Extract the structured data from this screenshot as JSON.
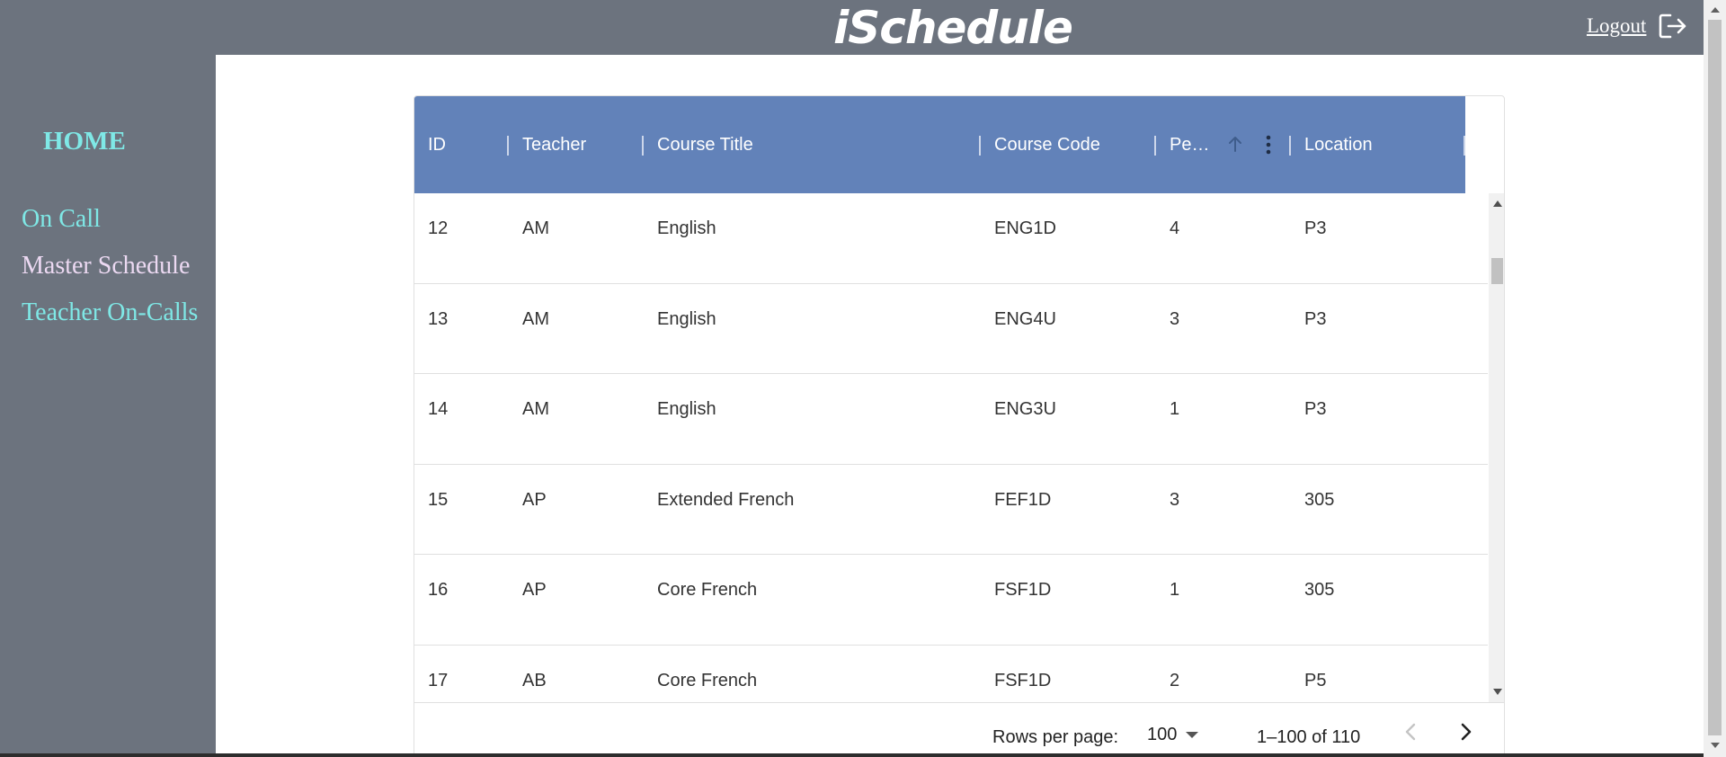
{
  "header": {
    "app_title": "iSchedule",
    "logout_label": "Logout",
    "logout_icon": "logout-icon"
  },
  "sidebar": {
    "home_label": "HOME",
    "items": [
      {
        "label": "On Call",
        "color": "#7fe8e6"
      },
      {
        "label": "Master Schedule",
        "color": "#ecd9f2"
      },
      {
        "label": "Teacher On-Calls",
        "color": "#7fe8e6"
      }
    ]
  },
  "grid": {
    "header_color": "#6282b9",
    "columns": [
      "ID",
      "Teacher",
      "Course Title",
      "Course Code",
      "Pe…",
      "Location"
    ],
    "sort": {
      "column": "Pe…",
      "direction": "ascending",
      "icon": "arrow-up-icon"
    },
    "column_menu_icon": "more-vert-icon",
    "rows": [
      [
        "12",
        "AM",
        "English",
        "ENG1D",
        "4",
        "P3"
      ],
      [
        "13",
        "AM",
        "English",
        "ENG4U",
        "3",
        "P3"
      ],
      [
        "14",
        "AM",
        "English",
        "ENG3U",
        "1",
        "P3"
      ],
      [
        "15",
        "AP",
        "Extended French",
        "FEF1D",
        "3",
        "305"
      ],
      [
        "16",
        "AP",
        "Core French",
        "FSF1D",
        "1",
        "305"
      ],
      [
        "17",
        "AB",
        "Core French",
        "FSF1D",
        "2",
        "P5"
      ]
    ],
    "footer": {
      "rows_per_page_label": "Rows per page:",
      "rows_per_page_value": "100",
      "range_text": "1–100 of 110",
      "prev_icon": "chevron-left-icon",
      "next_icon": "chevron-right-icon"
    }
  }
}
